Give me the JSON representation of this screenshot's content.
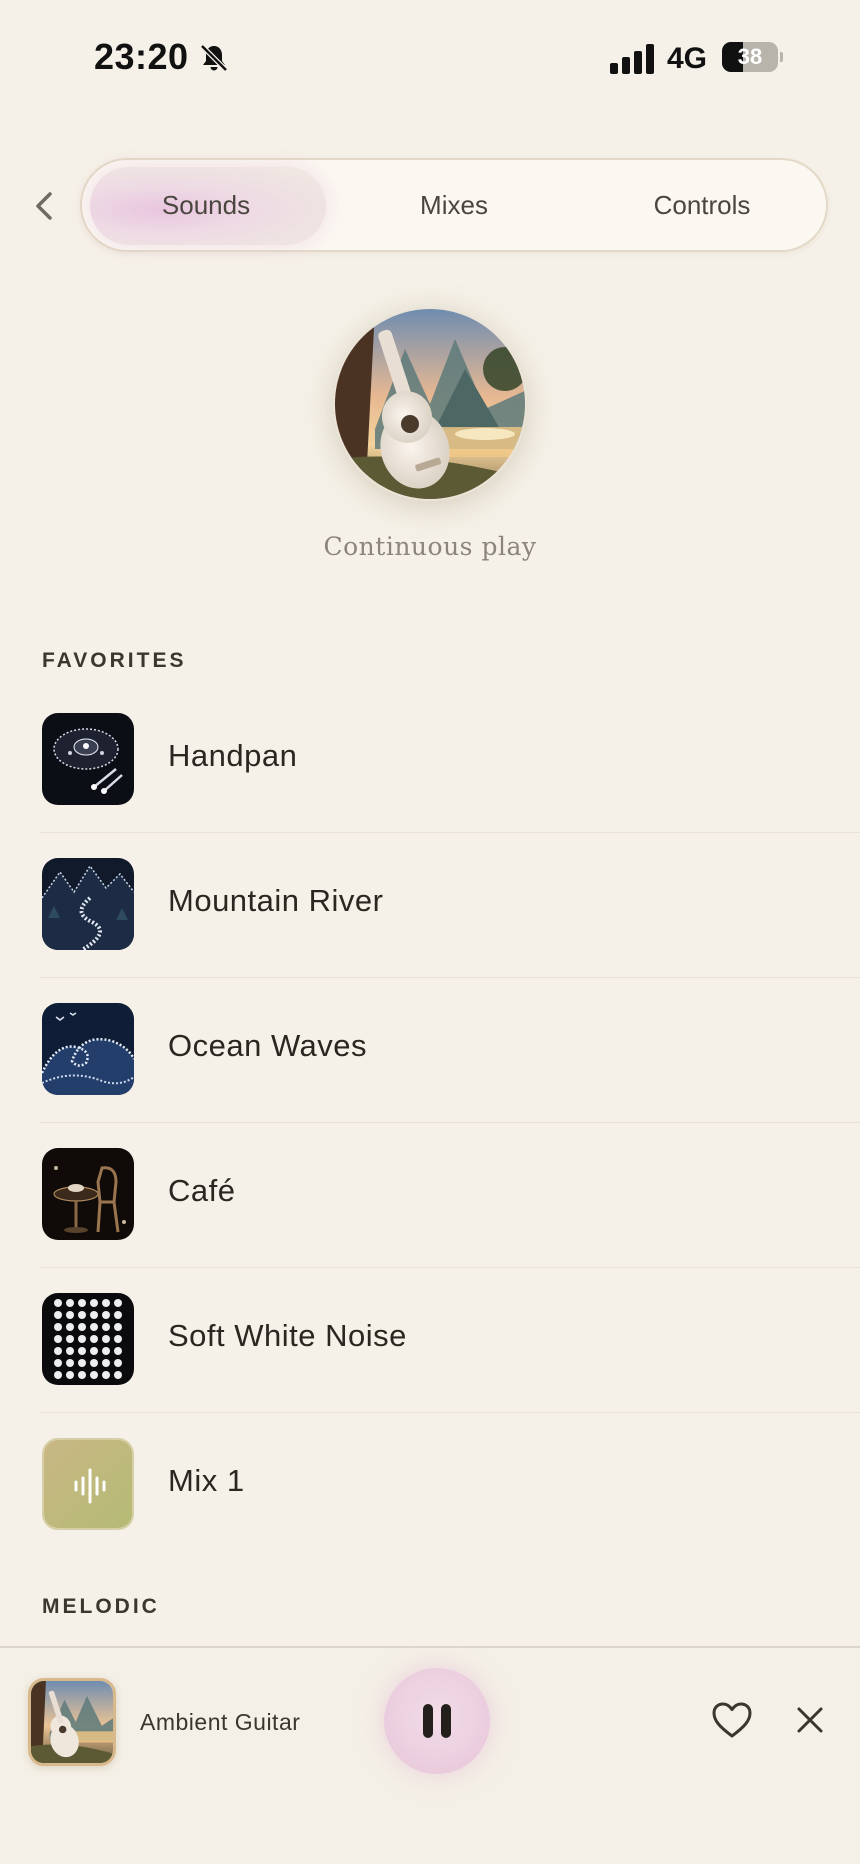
{
  "status": {
    "time": "23:20",
    "network": "4G",
    "battery": "38",
    "battery_level": 0.38
  },
  "tabs": [
    {
      "label": "Sounds",
      "selected": true
    },
    {
      "label": "Mixes",
      "selected": false
    },
    {
      "label": "Controls",
      "selected": false
    }
  ],
  "hero": {
    "caption": "Continuous play"
  },
  "sections": {
    "favorites": "FAVORITES",
    "melodic": "MELODIC"
  },
  "favorites": [
    {
      "label": "Handpan",
      "icon": "handpan-thumbnail"
    },
    {
      "label": "Mountain River",
      "icon": "mountain-river-thumbnail"
    },
    {
      "label": "Ocean Waves",
      "icon": "ocean-waves-thumbnail"
    },
    {
      "label": "Café",
      "icon": "cafe-thumbnail"
    },
    {
      "label": "Soft White Noise",
      "icon": "white-noise-thumbnail"
    },
    {
      "label": "Mix 1",
      "icon": "waveform-icon"
    }
  ],
  "player": {
    "title": "Ambient Guitar",
    "state": "playing"
  },
  "colors": {
    "background": "#f5f1e8",
    "accent_pink": "#ecd0e0",
    "mix_tile": "#bdb57a"
  }
}
